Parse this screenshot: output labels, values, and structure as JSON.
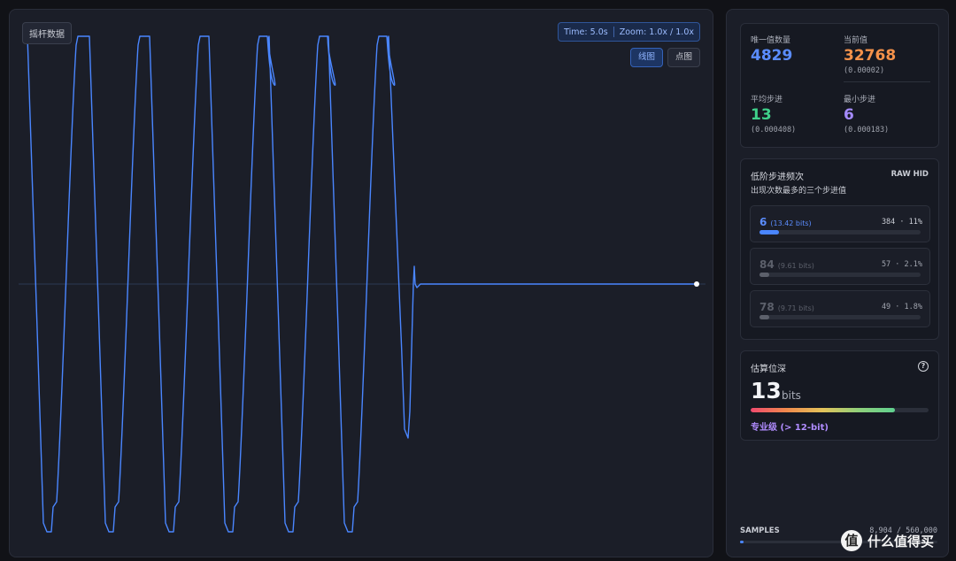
{
  "chart": {
    "tag": "摇杆数据",
    "time": "Time: 5.0s",
    "zoom": "Zoom: 1.0x / 1.0x",
    "mode_line": "线图",
    "mode_dot": "点图",
    "colors": {
      "line": "#4a86ff",
      "midline": "#2b3a55",
      "endpoint": "#ffffff"
    }
  },
  "stats": {
    "unique": {
      "label": "唯一值数量",
      "value": "4829",
      "color": "#5b8dff"
    },
    "current": {
      "label": "当前值",
      "value": "32768",
      "sub": "(0.00002)",
      "color": "#f5924a"
    },
    "avg": {
      "label": "平均步进",
      "value": "13",
      "sub": "(0.000408)",
      "color": "#3fd08a"
    },
    "min": {
      "label": "最小步进",
      "value": "6",
      "sub": "(0.000183)",
      "color": "#a58bff"
    }
  },
  "freq": {
    "title": "低阶步进频次",
    "badge": "RAW HID",
    "desc": "出现次数最多的三个步进值",
    "items": [
      {
        "step": "6",
        "bits": "(13.42 bits)",
        "count": "384 · 11%",
        "fraction": 0.11,
        "active": true
      },
      {
        "step": "84",
        "bits": "(9.61 bits)",
        "count": "57 · 2.1%",
        "fraction": 0.021,
        "active": false
      },
      {
        "step": "78",
        "bits": "(9.71 bits)",
        "count": "49 · 1.8%",
        "fraction": 0.018,
        "active": false
      }
    ]
  },
  "depth": {
    "title": "估算位深",
    "value": "13",
    "unit": "bits",
    "fraction": 0.81,
    "level": "专业级 (> 12-bit)"
  },
  "samples": {
    "label": "SAMPLES",
    "value": "8,904 / 560,000",
    "fraction": 0.016
  },
  "watermark": {
    "logo": "值",
    "text": "什么值得买"
  }
}
